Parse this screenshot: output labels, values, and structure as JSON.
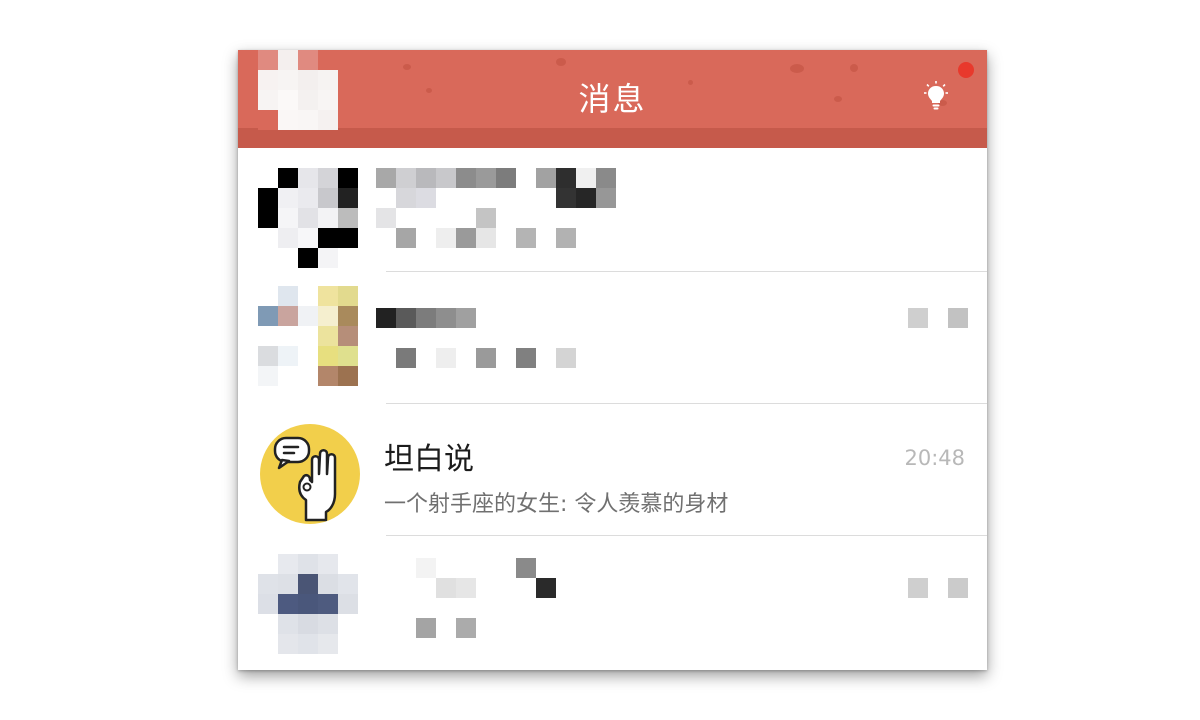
{
  "header": {
    "title": "消息",
    "accent_color": "#d9695a",
    "right_icon": "lightbulb-icon",
    "notification_dot_color": "#e8392c"
  },
  "conversations": [
    {
      "name": "",
      "preview": "",
      "time": "",
      "avatar": "blurred-avatar"
    },
    {
      "name": "",
      "preview": "",
      "time": "",
      "avatar": "blurred-avatar"
    },
    {
      "name": "坦白说",
      "preview": "一个射手座的女生: 令人羡慕的身材",
      "time": "20:48",
      "avatar": "hand-speech-icon"
    },
    {
      "name": "",
      "preview": "",
      "time": "",
      "avatar": "blurred-avatar"
    }
  ]
}
